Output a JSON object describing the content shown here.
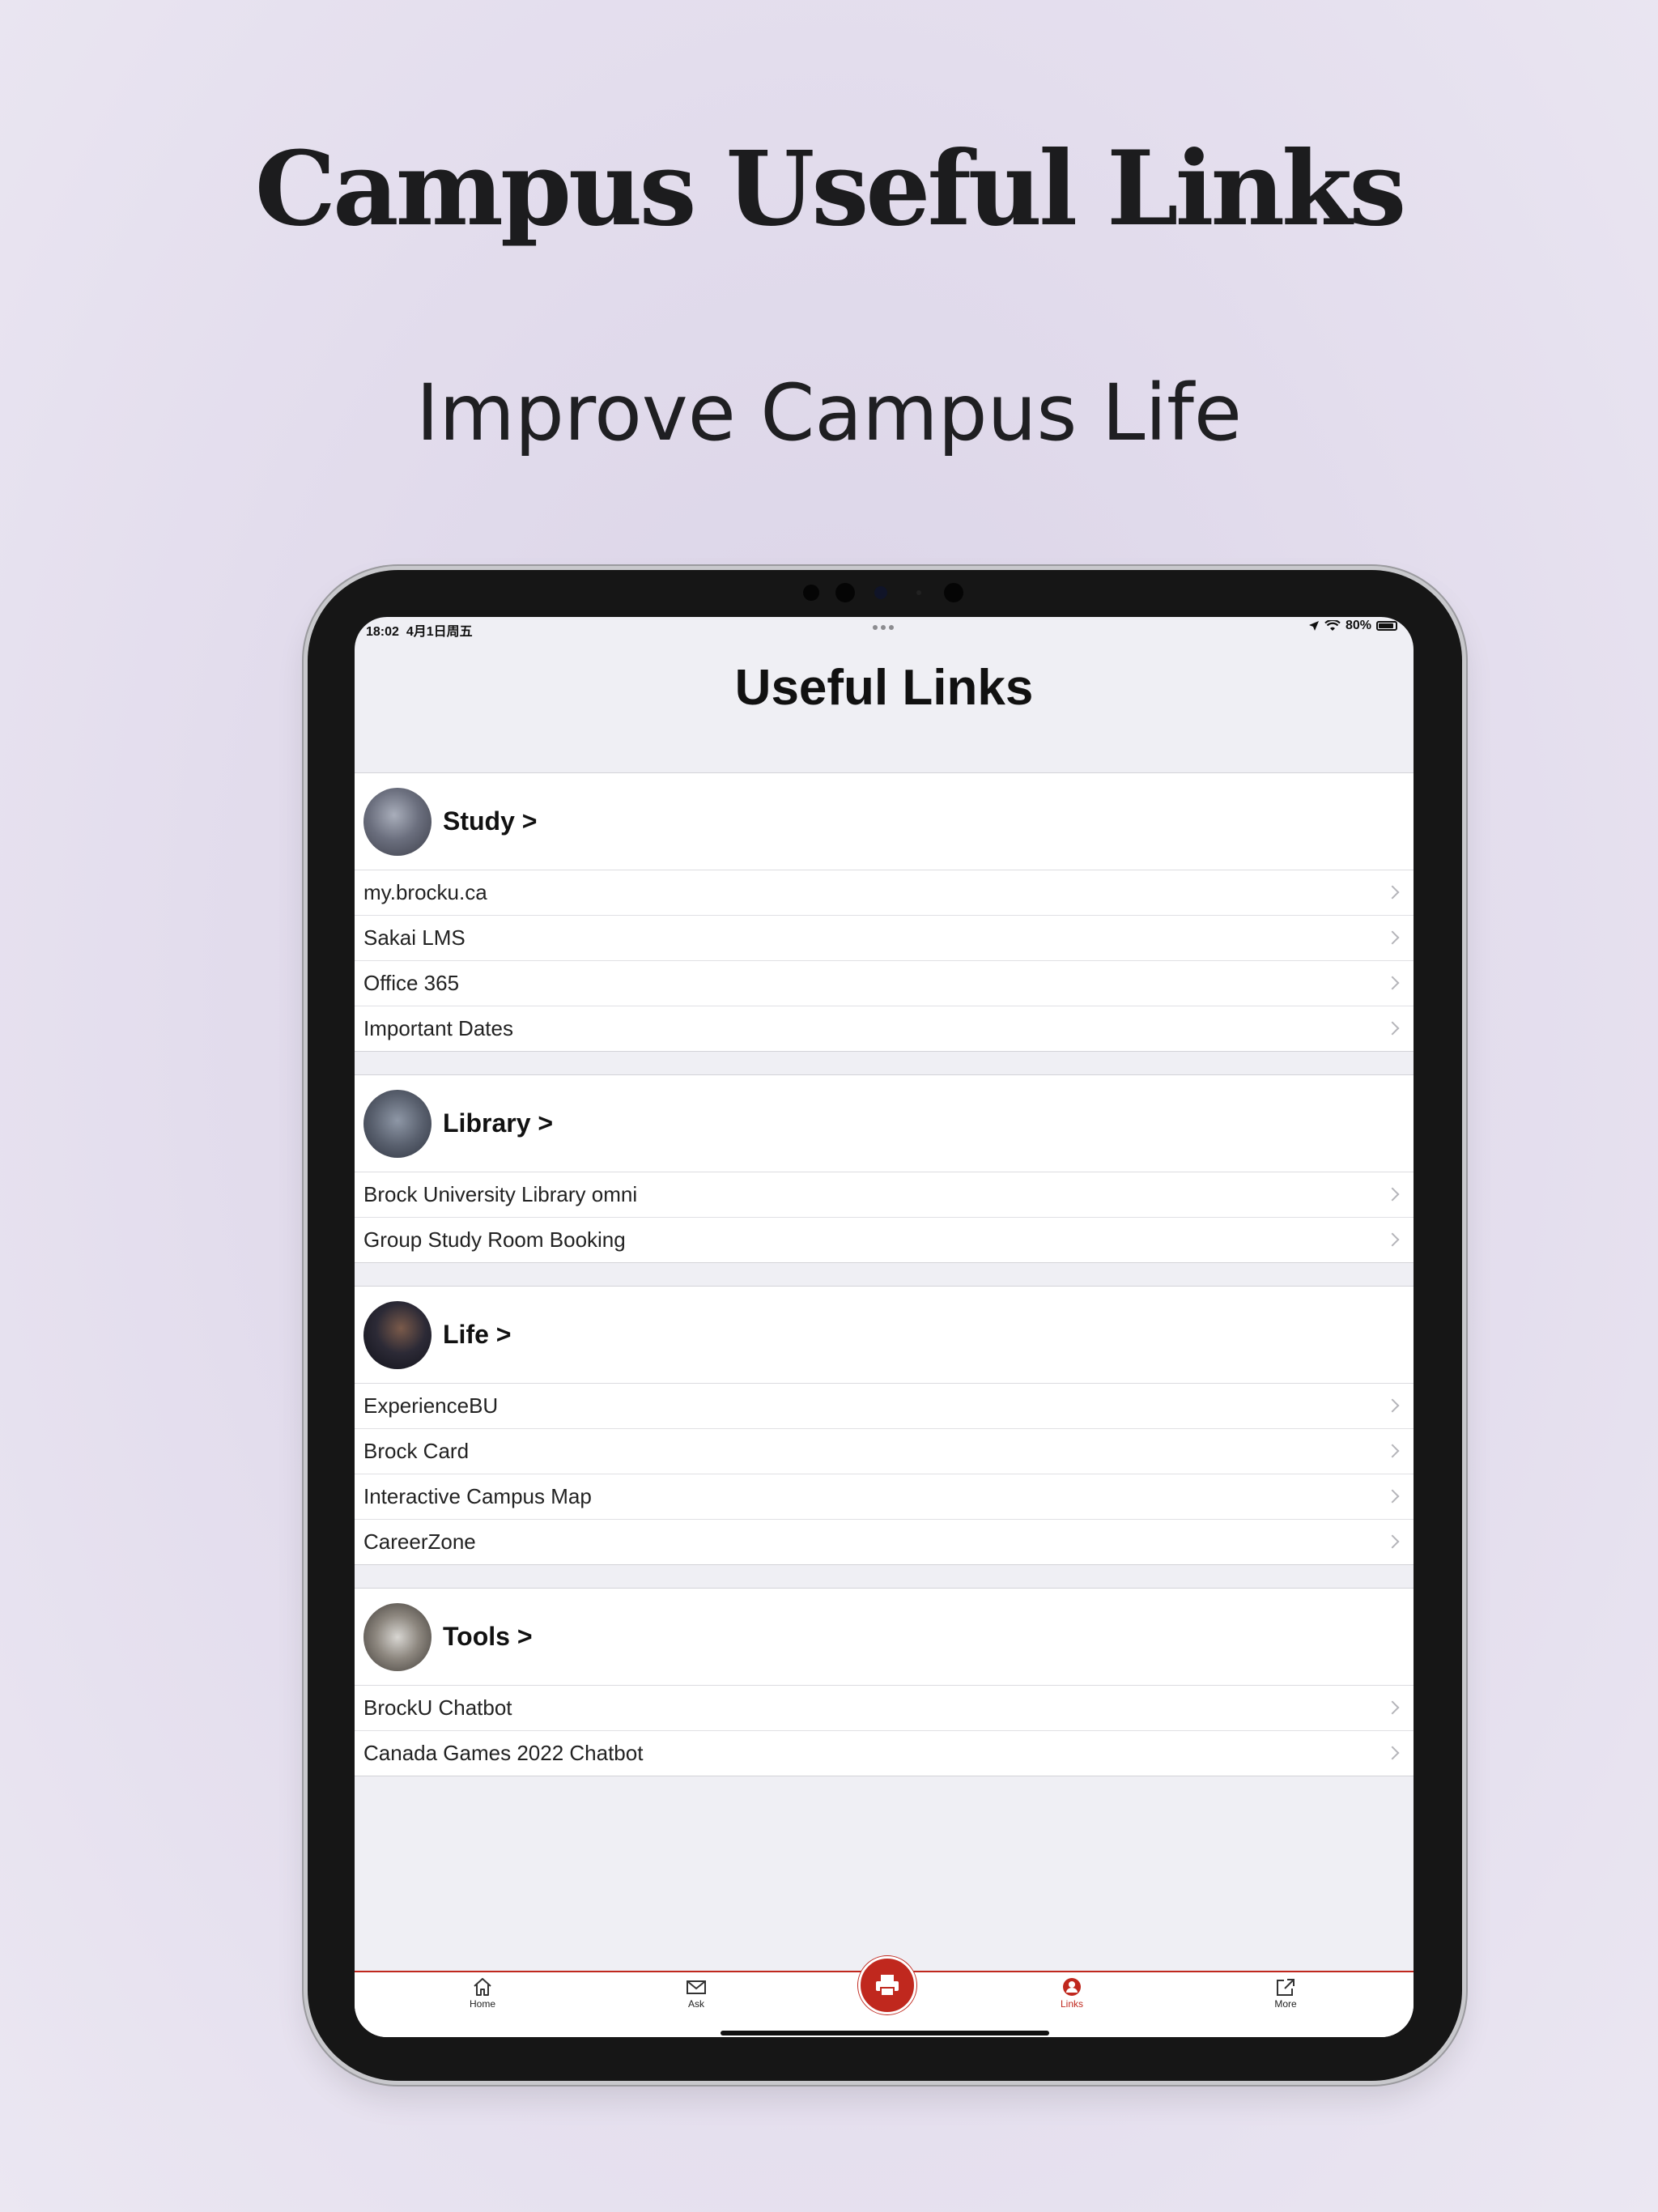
{
  "marketing": {
    "headline": "Campus Useful Links",
    "subheadline": "Improve Campus Life"
  },
  "status_bar": {
    "time": "18:02",
    "date": "4月1日周五",
    "battery": "80%"
  },
  "nav": {
    "title": "Useful Links"
  },
  "sections": [
    {
      "title": "Study >",
      "items": [
        {
          "label": "my.brocku.ca"
        },
        {
          "label": "Sakai LMS"
        },
        {
          "label": "Office 365"
        },
        {
          "label": "Important Dates"
        }
      ]
    },
    {
      "title": "Library >",
      "items": [
        {
          "label": "Brock University Library omni"
        },
        {
          "label": "Group Study Room Booking"
        }
      ]
    },
    {
      "title": "Life >",
      "items": [
        {
          "label": "ExperienceBU"
        },
        {
          "label": "Brock Card"
        },
        {
          "label": "Interactive Campus Map"
        },
        {
          "label": "CareerZone"
        }
      ]
    },
    {
      "title": "Tools >",
      "items": [
        {
          "label": "BrockU Chatbot"
        },
        {
          "label": "Canada Games 2022 Chatbot"
        }
      ]
    }
  ],
  "tabbar": {
    "tabs": [
      {
        "label": "Home",
        "icon": "house-icon"
      },
      {
        "label": "Ask",
        "icon": "envelope-icon"
      },
      {
        "label": "Links",
        "icon": "person-circle-icon",
        "active": true
      },
      {
        "label": "More",
        "icon": "external-link-icon"
      }
    ],
    "center_icon": "printer-icon"
  },
  "colors": {
    "accent": "#c0281e",
    "background": "#efeff4"
  }
}
